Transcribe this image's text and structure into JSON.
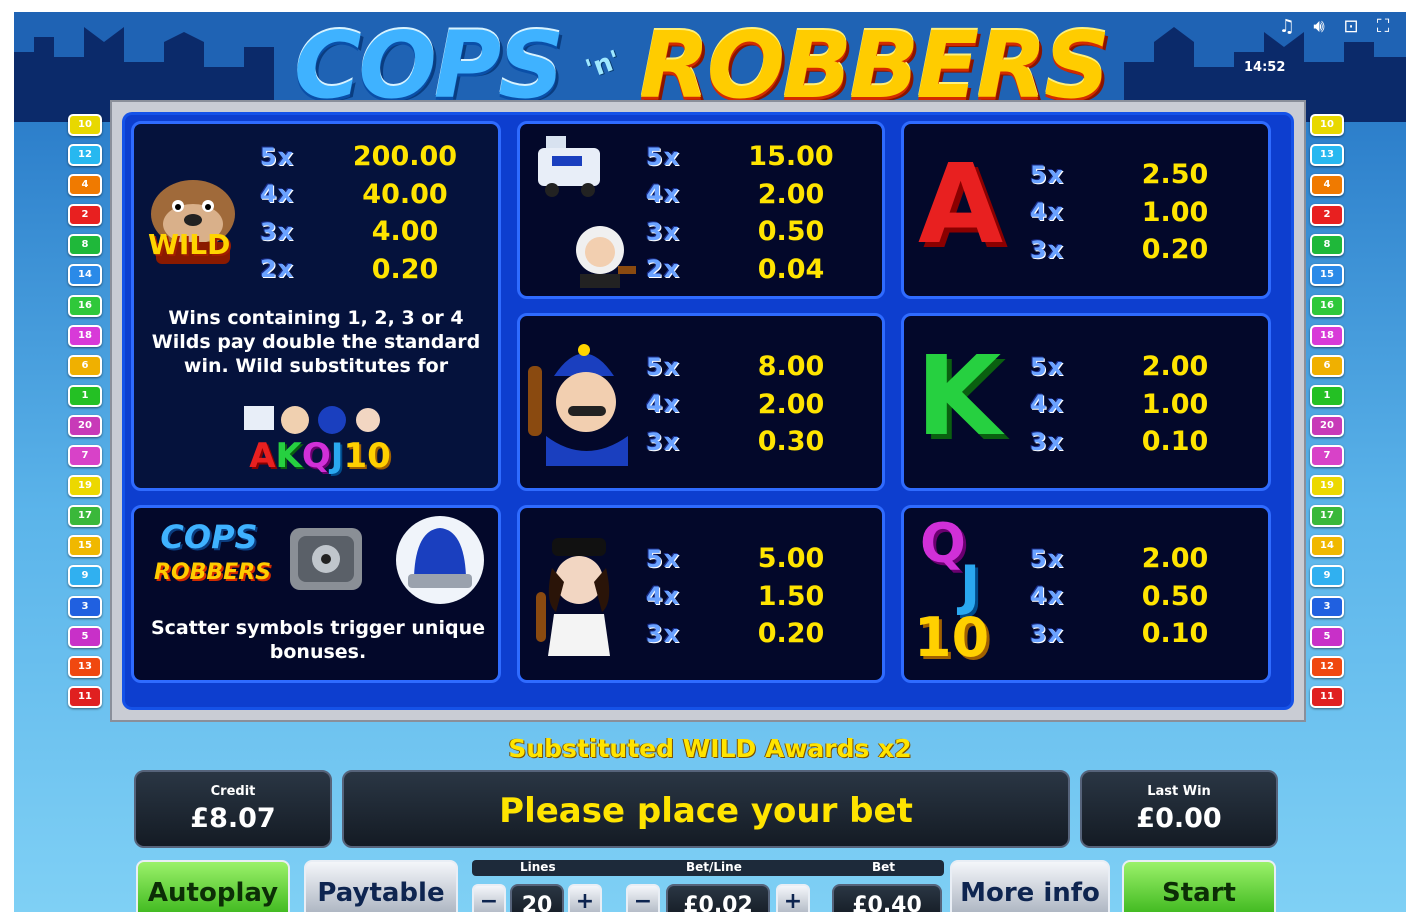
{
  "header": {
    "logo_left": "COPS",
    "logo_mid": "'n'",
    "logo_right": "ROBBERS",
    "clock": "14:52",
    "icons": [
      "music-icon",
      "speaker-icon",
      "resize-icon",
      "fullscreen-icon"
    ]
  },
  "paylines": {
    "left": [
      "10",
      "12",
      "4",
      "2",
      "8",
      "14",
      "16",
      "18",
      "6",
      "1",
      "20",
      "7",
      "19",
      "17",
      "15",
      "9",
      "3",
      "5",
      "13",
      "11"
    ],
    "right": [
      "10",
      "13",
      "4",
      "2",
      "8",
      "15",
      "16",
      "18",
      "6",
      "1",
      "20",
      "7",
      "19",
      "17",
      "14",
      "9",
      "3",
      "5",
      "12",
      "11"
    ],
    "colors": [
      "#e8d800",
      "#27b8f0",
      "#f07a00",
      "#e82020",
      "#1fb83a",
      "#2a8ae8",
      "#2fc83a",
      "#d83ad8",
      "#f0b000",
      "#24c024",
      "#c83ab8",
      "#d842c8",
      "#ecd800",
      "#3ab83a",
      "#f0b800",
      "#30b0f0",
      "#2060e0",
      "#c830c8",
      "#f04810",
      "#e02020"
    ]
  },
  "paytable": {
    "wild": {
      "label": "WILD",
      "pays": [
        {
          "mult": "5x",
          "amount": "200.00"
        },
        {
          "mult": "4x",
          "amount": "40.00"
        },
        {
          "mult": "3x",
          "amount": "4.00"
        },
        {
          "mult": "2x",
          "amount": "0.20"
        }
      ],
      "note": "Wins containing 1, 2, 3 or 4 Wilds pay double the standard win. Wild substitutes for",
      "sub_letters": [
        "A",
        "K",
        "Q",
        "J",
        "10"
      ]
    },
    "police_car": {
      "pays": [
        {
          "mult": "5x",
          "amount": "15.00"
        },
        {
          "mult": "4x",
          "amount": "2.00"
        },
        {
          "mult": "3x",
          "amount": "0.50"
        },
        {
          "mult": "2x",
          "amount": "0.04"
        }
      ]
    },
    "A": {
      "letter": "A",
      "pays": [
        {
          "mult": "5x",
          "amount": "2.50"
        },
        {
          "mult": "4x",
          "amount": "1.00"
        },
        {
          "mult": "3x",
          "amount": "0.20"
        }
      ]
    },
    "policeman": {
      "pays": [
        {
          "mult": "5x",
          "amount": "8.00"
        },
        {
          "mult": "4x",
          "amount": "2.00"
        },
        {
          "mult": "3x",
          "amount": "0.30"
        }
      ]
    },
    "K": {
      "letter": "K",
      "pays": [
        {
          "mult": "5x",
          "amount": "2.00"
        },
        {
          "mult": "4x",
          "amount": "1.00"
        },
        {
          "mult": "3x",
          "amount": "0.10"
        }
      ]
    },
    "scatter": {
      "logo_top": "COPS",
      "logo_bottom": "ROBBERS",
      "note": "Scatter symbols trigger unique bonuses."
    },
    "policewoman": {
      "pays": [
        {
          "mult": "5x",
          "amount": "5.00"
        },
        {
          "mult": "4x",
          "amount": "1.50"
        },
        {
          "mult": "3x",
          "amount": "0.20"
        }
      ]
    },
    "QJ10": {
      "letters": [
        "Q",
        "J",
        "10"
      ],
      "pays": [
        {
          "mult": "5x",
          "amount": "2.00"
        },
        {
          "mult": "4x",
          "amount": "0.50"
        },
        {
          "mult": "3x",
          "amount": "0.10"
        }
      ]
    }
  },
  "status": {
    "wild_message": "Substituted WILD Awards x2",
    "credit_label": "Credit",
    "credit_value": "£8.07",
    "message": "Please place your bet",
    "last_win_label": "Last Win",
    "last_win_value": "£0.00"
  },
  "controls": {
    "autoplay": "Autoplay",
    "paytable": "Paytable",
    "lines_label": "Lines",
    "betline_label": "Bet/Line",
    "bet_label": "Bet",
    "lines_value": "20",
    "betline_value": "£0.02",
    "bet_value": "£0.40",
    "minus": "−",
    "plus": "+",
    "more_info": "More info",
    "start": "Start"
  }
}
